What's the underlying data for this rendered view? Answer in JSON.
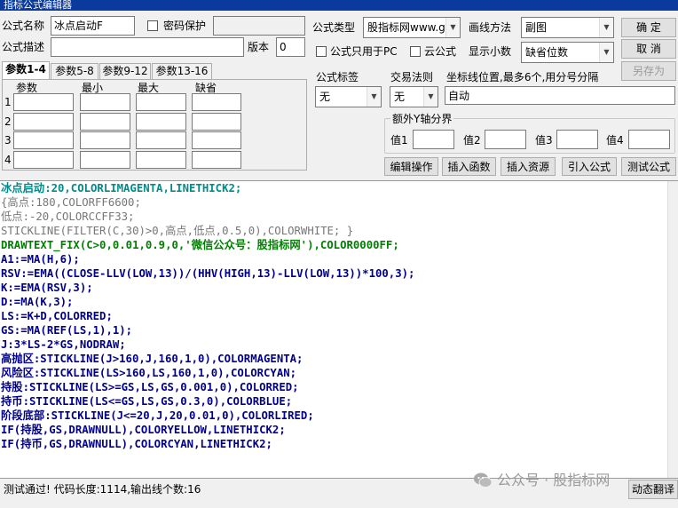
{
  "window": {
    "title": "指标公式编辑器"
  },
  "form": {
    "name_label": "公式名称",
    "name_value": "冰点启动F",
    "password_label": "密码保护",
    "desc_label": "公式描述",
    "version_label": "版本",
    "version_value": "0",
    "type_label": "公式类型",
    "type_value": "股指标网www.g",
    "draw_label": "画线方法",
    "draw_value": "副图",
    "pc_only_label": "公式只用于PC",
    "cloud_label": "云公式",
    "decimals_label": "显示小数",
    "decimals_value": "缺省位数"
  },
  "buttons": {
    "ok": "确 定",
    "cancel": "取 消",
    "save_as": "另存为"
  },
  "tabs": [
    {
      "label": "参数1-4"
    },
    {
      "label": "参数5-8"
    },
    {
      "label": "参数9-12"
    },
    {
      "label": "参数13-16"
    }
  ],
  "params": {
    "headers": [
      "参数",
      "最小",
      "最大",
      "缺省"
    ],
    "rows": [
      "1",
      "2",
      "3",
      "4"
    ]
  },
  "tag": {
    "label": "公式标签",
    "value": "无"
  },
  "trade": {
    "label": "交易法则",
    "value": "无"
  },
  "coords": {
    "label": "坐标线位置,最多6个,用分号分隔",
    "value": "自动"
  },
  "yaxis": {
    "title": "额外Y轴分界",
    "labels": [
      "值1",
      "值2",
      "值3",
      "值4"
    ]
  },
  "actions": [
    "编辑操作",
    "插入函数",
    "插入资源",
    "引入公式",
    "测试公式"
  ],
  "code_lines": [
    "冰点启动:20,COLORLIMAGENTA,LINETHICK2;",
    "{高点:180,COLORFF6600;",
    "低点:-20,COLORCCFF33;",
    "STICKLINE(FILTER(C,30)>0,高点,低点,0.5,0),COLORWHITE; }",
    "DRAWTEXT_FIX(C>0,0.01,0.9,0,'微信公众号：股指标网'),COLOR0000FF;",
    "A1:=MA(H,6);",
    "RSV:=EMA((CLOSE-LLV(LOW,13))/(HHV(HIGH,13)-LLV(LOW,13))*100,3);",
    "K:=EMA(RSV,3);",
    "D:=MA(K,3);",
    "LS:=K+D,COLORRED;",
    "GS:=MA(REF(LS,1),1);",
    "J:3*LS-2*GS,NODRAW;",
    "高抛区:STICKLINE(J>160,J,160,1,0),COLORMAGENTA;",
    "风险区:STICKLINE(LS>160,LS,160,1,0),COLORCYAN;",
    "持股:STICKLINE(LS>=GS,LS,GS,0.001,0),COLORRED;",
    "持币:STICKLINE(LS<=GS,LS,GS,0.3,0),COLORBLUE;",
    "阶段底部:STICKLINE(J<=20,J,20,0.01,0),COLORLIRED;",
    "IF(持股,GS,DRAWNULL),COLORYELLOW,LINETHICK2;",
    "IF(持币,GS,DRAWNULL),COLORCYAN,LINETHICK2;"
  ],
  "status": {
    "text": "测试通过! 代码长度:1114,输出线个数:16",
    "watermark": "公众号 · 股指标网",
    "button": "动态翻译"
  },
  "colors": {
    "title_bar": "#0a3a9e",
    "keyword": "#0000ff",
    "number": "#ff6600",
    "var": "#008000",
    "name": "#008b8b"
  }
}
